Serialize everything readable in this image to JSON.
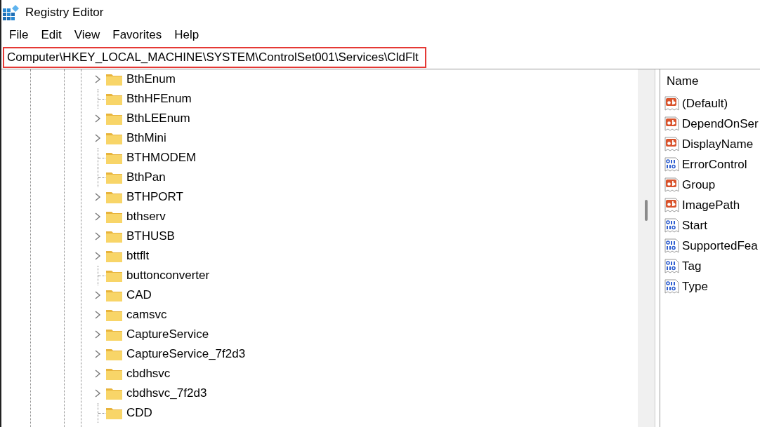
{
  "window": {
    "title": "Registry Editor"
  },
  "menu": [
    "File",
    "Edit",
    "View",
    "Favorites",
    "Help"
  ],
  "address_bar": {
    "value": "Computer\\HKEY_LOCAL_MACHINE\\SYSTEM\\ControlSet001\\Services\\CldFlt",
    "highlighted": true
  },
  "tree": {
    "items": [
      {
        "label": "BthEnum",
        "expandable": true
      },
      {
        "label": "BthHFEnum",
        "expandable": false
      },
      {
        "label": "BthLEEnum",
        "expandable": true
      },
      {
        "label": "BthMini",
        "expandable": true
      },
      {
        "label": "BTHMODEM",
        "expandable": false
      },
      {
        "label": "BthPan",
        "expandable": false
      },
      {
        "label": "BTHPORT",
        "expandable": true
      },
      {
        "label": "bthserv",
        "expandable": true
      },
      {
        "label": "BTHUSB",
        "expandable": true
      },
      {
        "label": "bttflt",
        "expandable": true
      },
      {
        "label": "buttonconverter",
        "expandable": false
      },
      {
        "label": "CAD",
        "expandable": true
      },
      {
        "label": "camsvc",
        "expandable": true
      },
      {
        "label": "CaptureService",
        "expandable": true
      },
      {
        "label": "CaptureService_7f2d3",
        "expandable": true
      },
      {
        "label": "cbdhsvc",
        "expandable": true
      },
      {
        "label": "cbdhsvc_7f2d3",
        "expandable": true
      },
      {
        "label": "CDD",
        "expandable": false
      }
    ]
  },
  "values": {
    "columns": [
      "Name"
    ],
    "rows": [
      {
        "name": "(Default)",
        "kind": "string"
      },
      {
        "name": "DependOnSer",
        "kind": "string"
      },
      {
        "name": "DisplayName",
        "kind": "string"
      },
      {
        "name": "ErrorControl",
        "kind": "binary"
      },
      {
        "name": "Group",
        "kind": "string"
      },
      {
        "name": "ImagePath",
        "kind": "string"
      },
      {
        "name": "Start",
        "kind": "binary"
      },
      {
        "name": "SupportedFea",
        "kind": "binary"
      },
      {
        "name": "Tag",
        "kind": "binary"
      },
      {
        "name": "Type",
        "kind": "binary"
      }
    ]
  }
}
